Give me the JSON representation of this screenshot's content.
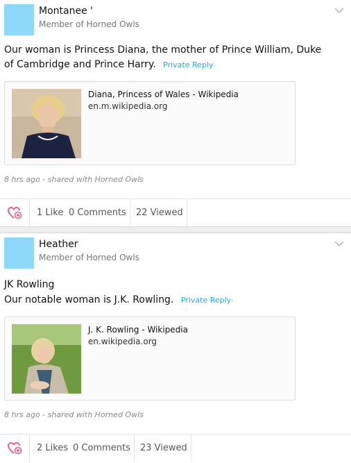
{
  "posts": [
    {
      "author": "Montanee '",
      "role": "Member of Horned Owls",
      "subject": "",
      "body": "Our woman is Princess Diana, the mother of Prince William, Duke of Cambridge and Prince Harry.",
      "reply_label": "Private Reply",
      "link": {
        "title": "Diana, Princess of Wales - Wikipedia",
        "url": "en.m.wikipedia.org"
      },
      "meta": "8 hrs ago - shared with Horned Owls",
      "likes": "1 Like",
      "comments": "0 Comments",
      "viewed": "22 Viewed"
    },
    {
      "author": "Heather",
      "role": "Member of Horned Owls",
      "subject": "JK Rowling",
      "body": "Our notable woman is J.K. Rowling.",
      "reply_label": "Private Reply",
      "link": {
        "title": "J. K. Rowling - Wikipedia",
        "url": "en.wikipedia.org"
      },
      "meta": "8 hrs ago - shared with Horned Owls",
      "likes": "2 Likes",
      "comments": "0 Comments",
      "viewed": "23 Viewed"
    }
  ],
  "colors": {
    "avatar": "#8fd9f8",
    "accent": "#29a8d6",
    "like_heart": "#e8628a"
  },
  "icons": {
    "like": "heart-plus-icon",
    "menu": "chevron-down-icon"
  }
}
